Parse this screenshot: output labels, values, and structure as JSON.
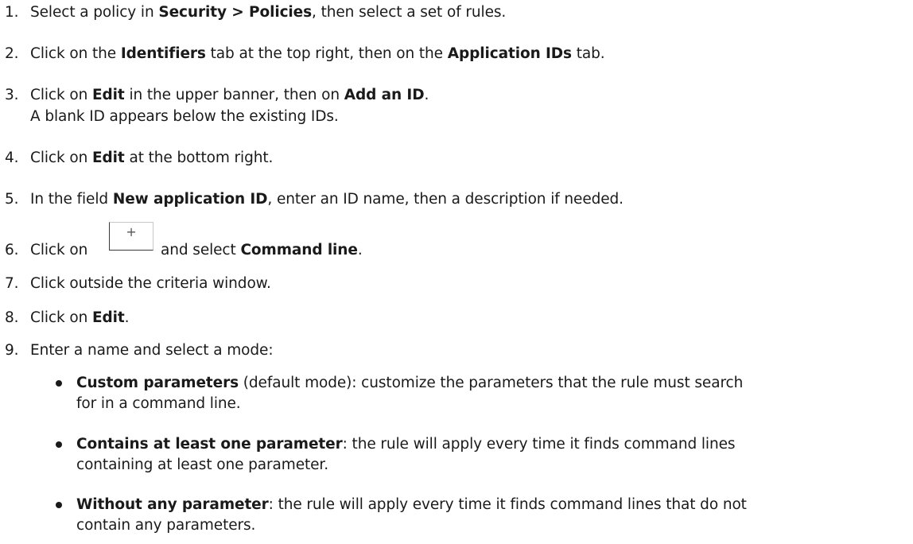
{
  "steps": [
    {
      "num": "1.",
      "a": "Select a policy in ",
      "b1": "Security > Policies",
      "c": ", then select a set of rules."
    },
    {
      "num": "2.",
      "a": "Click on the ",
      "b1": "Identifiers",
      "c": " tab at the top right, then on the ",
      "b2": "Application IDs",
      "d": " tab."
    },
    {
      "num": "3.",
      "a": "Click on ",
      "b1": "Edit",
      "c": " in the upper banner, then on ",
      "b2": "Add an ID",
      "d": ".",
      "sub": "A blank ID appears below the existing IDs."
    },
    {
      "num": "4.",
      "a": "Click on ",
      "b1": "Edit",
      "c": " at the bottom right."
    },
    {
      "num": "5.",
      "a": "In the field ",
      "b1": "New application ID",
      "c": ", enter an ID name, then a description if needed."
    },
    {
      "num": "6.",
      "a": "Click on",
      "plus": "+",
      "c": "and select ",
      "b1": "Command line",
      "d": "."
    },
    {
      "num": "7.",
      "a": "Click outside the criteria window."
    },
    {
      "num": "8.",
      "a": "Click on ",
      "b1": "Edit",
      "c": "."
    },
    {
      "num": "9.",
      "a": "Enter a name and select a mode:"
    }
  ],
  "modes": [
    {
      "name": "Custom parameters",
      "desc1": " (default mode): customize the parameters that the rule must search",
      "desc2": "for in a command line."
    },
    {
      "name": "Contains at least one parameter",
      "desc1": ": the rule will apply every time it finds command lines",
      "desc2": "containing at least one parameter."
    },
    {
      "name": "Without any parameter",
      "desc1": ": the rule will apply every time it finds command lines that do not",
      "desc2": "contain any parameters."
    }
  ]
}
